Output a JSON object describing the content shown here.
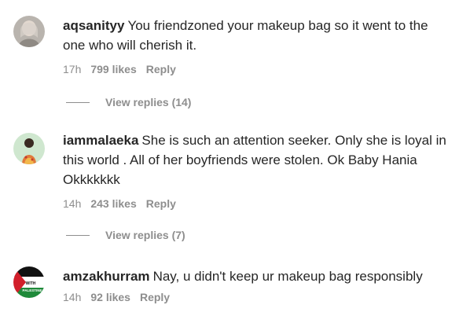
{
  "comments": [
    {
      "username": "aqsanityy",
      "text": "You friendzoned your makeup bag so it went to the one who will cherish it.",
      "time": "17h",
      "likes": "799 likes",
      "reply": "Reply",
      "view_replies": "View replies (14)"
    },
    {
      "username": "iammalaeka",
      "text": "She is such an attention seeker. Only she is loyal in this world . All of her boyfriends were stolen. Ok Baby Hania Okkkkkkk",
      "time": "14h",
      "likes": "243 likes",
      "reply": "Reply",
      "view_replies": "View replies (7)"
    },
    {
      "username": "amzakhurram",
      "text": "Nay, u didn't keep ur makeup bag responsibly",
      "time": "14h",
      "likes": "92 likes",
      "reply": "Reply",
      "avatar_text": "WITH PALESTINE"
    }
  ]
}
